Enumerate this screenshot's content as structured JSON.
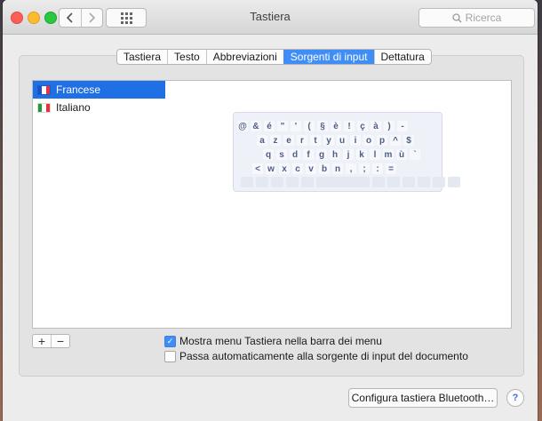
{
  "window": {
    "title": "Tastiera"
  },
  "search": {
    "placeholder": "Ricerca",
    "icon": "magnifier"
  },
  "tabs": [
    {
      "label": "Tastiera",
      "active": false
    },
    {
      "label": "Testo",
      "active": false
    },
    {
      "label": "Abbreviazioni",
      "active": false
    },
    {
      "label": "Sorgenti di input",
      "active": true
    },
    {
      "label": "Dettatura",
      "active": false
    }
  ],
  "sources": [
    {
      "label": "Francese",
      "selected": true,
      "flag": [
        "#1f4fc4",
        "#ffffff",
        "#e8323c"
      ]
    },
    {
      "label": "Italiano",
      "selected": false,
      "flag": [
        "#1f9c3a",
        "#ffffff",
        "#e8323c"
      ]
    }
  ],
  "keyboard_rows": [
    [
      "@",
      "&",
      "é",
      "\"",
      "'",
      "(",
      "§",
      "è",
      "!",
      "ç",
      "à",
      ")",
      "-"
    ],
    [
      "a",
      "z",
      "e",
      "r",
      "t",
      "y",
      "u",
      "i",
      "o",
      "p",
      "^",
      "$"
    ],
    [
      "q",
      "s",
      "d",
      "f",
      "g",
      "h",
      "j",
      "k",
      "l",
      "m",
      "ù",
      "`"
    ],
    [
      "<",
      "w",
      "x",
      "c",
      "v",
      "b",
      "n",
      ",",
      ";",
      ":",
      "="
    ]
  ],
  "list_buttons": {
    "add": "+",
    "remove": "−"
  },
  "options": [
    {
      "label": "Mostra menu Tastiera nella barra dei menu",
      "checked": true
    },
    {
      "label": "Passa automaticamente alla sorgente di input del documento",
      "checked": false
    }
  ],
  "bluetooth_button": "Configura tastiera Bluetooth…",
  "help_label": "?",
  "colors": {
    "accent": "#1f6fe5",
    "tab_active": "#3f8ef7"
  }
}
